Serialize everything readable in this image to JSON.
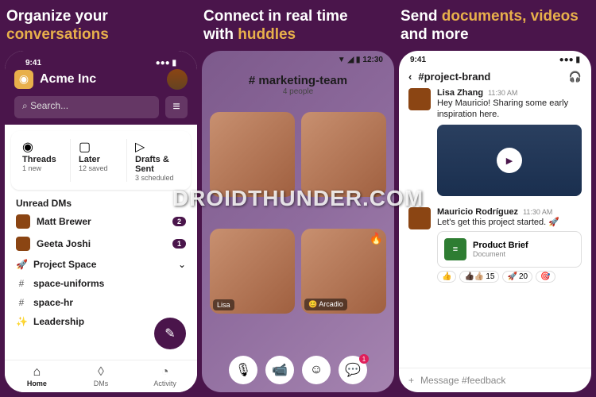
{
  "watermark": "DROIDTHUNDER.COM",
  "panels": [
    {
      "headline1": "Organize your",
      "headline2": "conversations"
    },
    {
      "headline1": "Connect in real time",
      "headline2": "with ",
      "accent": "huddles"
    },
    {
      "headline1": "Send ",
      "accent": "documents, videos",
      "headline2": " and more"
    }
  ],
  "p1": {
    "time": "9:41",
    "workspace": "Acme Inc",
    "search_placeholder": "Search...",
    "cards": [
      {
        "title": "Threads",
        "sub": "1 new"
      },
      {
        "title": "Later",
        "sub": "12 saved"
      },
      {
        "title": "Drafts & Sent",
        "sub": "3 scheduled"
      }
    ],
    "section_unread": "Unread DMs",
    "dms": [
      {
        "name": "Matt Brewer",
        "badge": "2"
      },
      {
        "name": "Geeta Joshi",
        "badge": "1"
      }
    ],
    "space": "Project Space",
    "channels": [
      "space-uniforms",
      "space-hr"
    ],
    "leadership": "Leadership",
    "tabs": [
      {
        "label": "Home",
        "active": true
      },
      {
        "label": "DMs",
        "active": false
      },
      {
        "label": "Activity",
        "active": false
      }
    ]
  },
  "p2": {
    "time": "12:30",
    "channel": "marketing-team",
    "people": "4 people",
    "tiles": [
      {
        "label": ""
      },
      {
        "label": ""
      },
      {
        "label": "Lisa"
      },
      {
        "label": "Arcadio",
        "fire": true
      }
    ],
    "chat_badge": "1"
  },
  "p3": {
    "time": "9:41",
    "channel": "#project-brand",
    "messages": [
      {
        "name": "Lisa Zhang",
        "time": "11:30 AM",
        "text": "Hey Mauricio! Sharing some early inspiration here."
      },
      {
        "name": "Mauricio Rodríguez",
        "time": "11:30 AM",
        "text": "Let's get this project started. 🚀"
      }
    ],
    "attachment": {
      "title": "Product Brief",
      "sub": "Document"
    },
    "reactions": [
      {
        "emoji": "👍",
        "count": ""
      },
      {
        "emoji": "👍🏿👍🏼",
        "count": "15"
      },
      {
        "emoji": "🚀",
        "count": "20"
      },
      {
        "emoji": "🎯",
        "count": ""
      }
    ],
    "composer": "Message #feedback"
  }
}
